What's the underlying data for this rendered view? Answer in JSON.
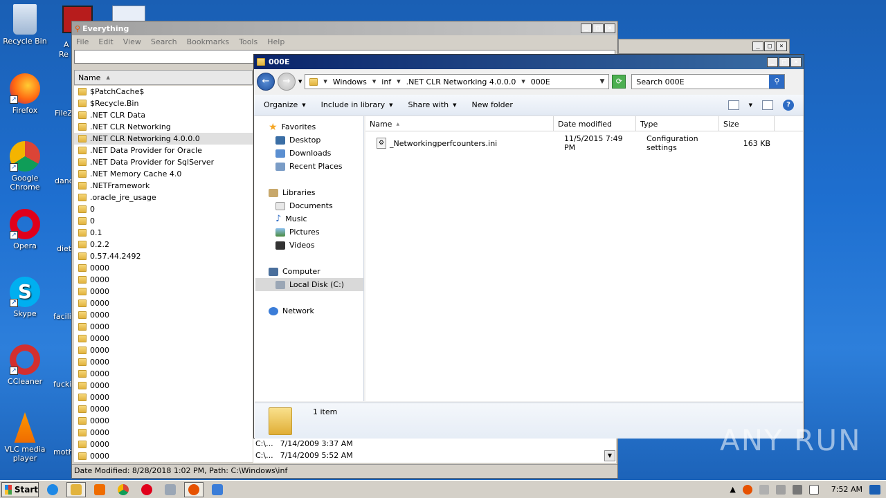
{
  "desktop": {
    "icons": [
      {
        "label": "Recycle Bin"
      },
      {
        "label": "Firefox"
      },
      {
        "label": "Google Chrome"
      },
      {
        "label": "Opera"
      },
      {
        "label": "Skype"
      },
      {
        "label": "CCleaner"
      },
      {
        "label": "VLC media player"
      }
    ],
    "partial_labels": [
      "A",
      "Re",
      "FileZ",
      "danc",
      "diet",
      "facili",
      "fucki",
      "moth"
    ]
  },
  "everything": {
    "title": "Everything",
    "menu": [
      "File",
      "Edit",
      "View",
      "Search",
      "Bookmarks",
      "Tools",
      "Help"
    ],
    "column_name": "Name",
    "items": [
      "$PatchCache$",
      "$Recycle.Bin",
      ".NET CLR Data",
      ".NET CLR Networking",
      ".NET CLR Networking 4.0.0.0",
      ".NET Data Provider for Oracle",
      ".NET Data Provider for SqlServer",
      ".NET Memory Cache 4.0",
      ".NETFramework",
      ".oracle_jre_usage",
      "0",
      "0",
      "0.1",
      "0.2.2",
      "0.57.44.2492",
      "0000",
      "0000",
      "0000",
      "0000",
      "0000",
      "0000",
      "0000",
      "0000",
      "0000",
      "0000",
      "0000",
      "0000",
      "0000",
      "0000",
      "0000",
      "0000",
      "0000"
    ],
    "selected_index": 4,
    "bottom_rows": [
      {
        "path": "C:\\...",
        "date": "7/14/2009 3:37 AM"
      },
      {
        "path": "C:\\...",
        "date": "7/14/2009 5:52 AM"
      }
    ],
    "status": "Date Modified: 8/28/2018 1:02 PM, Path: C:\\Windows\\inf"
  },
  "explorer": {
    "title": "000E",
    "breadcrumb": [
      "Windows",
      "inf",
      ".NET CLR Networking 4.0.0.0",
      "000E"
    ],
    "search_placeholder": "Search 000E",
    "toolbar": {
      "organize": "Organize",
      "include": "Include in library",
      "share": "Share with",
      "new_folder": "New folder"
    },
    "nav": {
      "favorites": "Favorites",
      "desktop": "Desktop",
      "downloads": "Downloads",
      "recent": "Recent Places",
      "libraries": "Libraries",
      "documents": "Documents",
      "music": "Music",
      "pictures": "Pictures",
      "videos": "Videos",
      "computer": "Computer",
      "local_disk": "Local Disk (C:)",
      "network": "Network"
    },
    "columns": {
      "name": "Name",
      "date": "Date modified",
      "type": "Type",
      "size": "Size"
    },
    "files": [
      {
        "name": "_Networkingperfcounters.ini",
        "date": "11/5/2015 7:49 PM",
        "type": "Configuration settings",
        "size": "163 KB"
      }
    ],
    "item_count": "1 item"
  },
  "taskbar": {
    "start": "Start",
    "clock": "7:52 AM"
  },
  "watermark": "ANY RUN"
}
